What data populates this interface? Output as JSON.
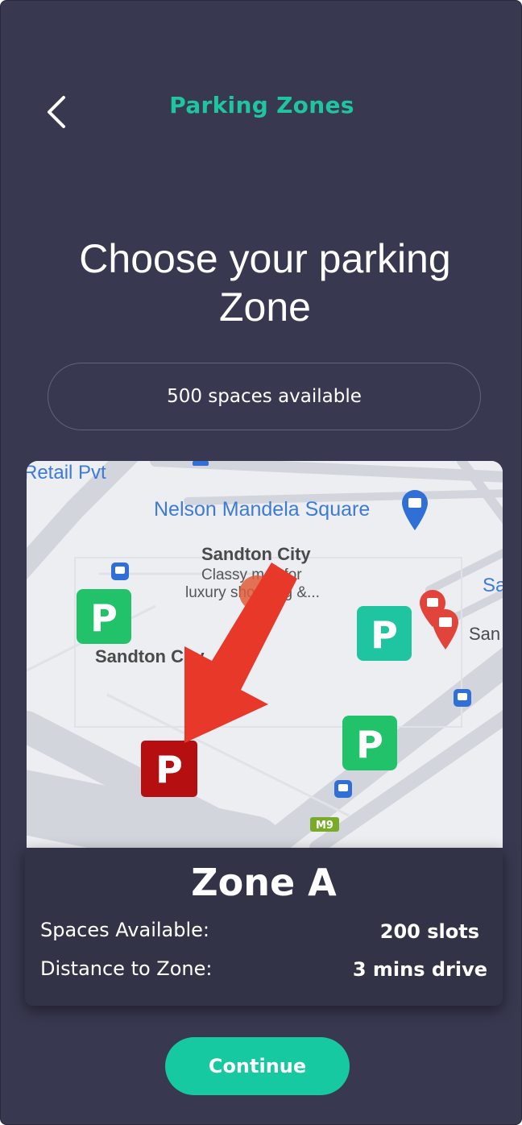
{
  "header": {
    "title": "Parking Zones",
    "back_icon": "chevron-left-icon"
  },
  "headline": "Choose your parking Zone",
  "availability": {
    "label": "500 spaces available"
  },
  "map": {
    "labels": {
      "retail": "Retail Pvt",
      "nelson_square": "Nelson Mandela Square",
      "sandton_city_title": "Sandton City",
      "sandton_city_sub1": "Classy mall for",
      "sandton_city_sub2": "luxury shopping &...",
      "sandton_city_road": "Sandton City",
      "right_sa": "Sa",
      "right_san": "San",
      "road_shield": "M9"
    },
    "markers": [
      {
        "name": "parking-marker-1",
        "color": "#22c26a",
        "glyph": "P"
      },
      {
        "name": "parking-marker-2",
        "color": "#1fc5a0",
        "glyph": "P"
      },
      {
        "name": "parking-marker-3",
        "color": "#22c26a",
        "glyph": "P"
      },
      {
        "name": "parking-marker-selected",
        "color": "#b50f12",
        "glyph": "P"
      }
    ],
    "arrow_color": "#e8382a"
  },
  "zone": {
    "name": "Zone A",
    "spaces_label": "Spaces Available:",
    "spaces_value": "200 slots",
    "distance_label": "Distance to Zone:",
    "distance_value": "3 mins drive"
  },
  "actions": {
    "continue_label": "Continue"
  },
  "colors": {
    "background": "#383850",
    "accent": "#17c9a1",
    "card": "#333348"
  }
}
